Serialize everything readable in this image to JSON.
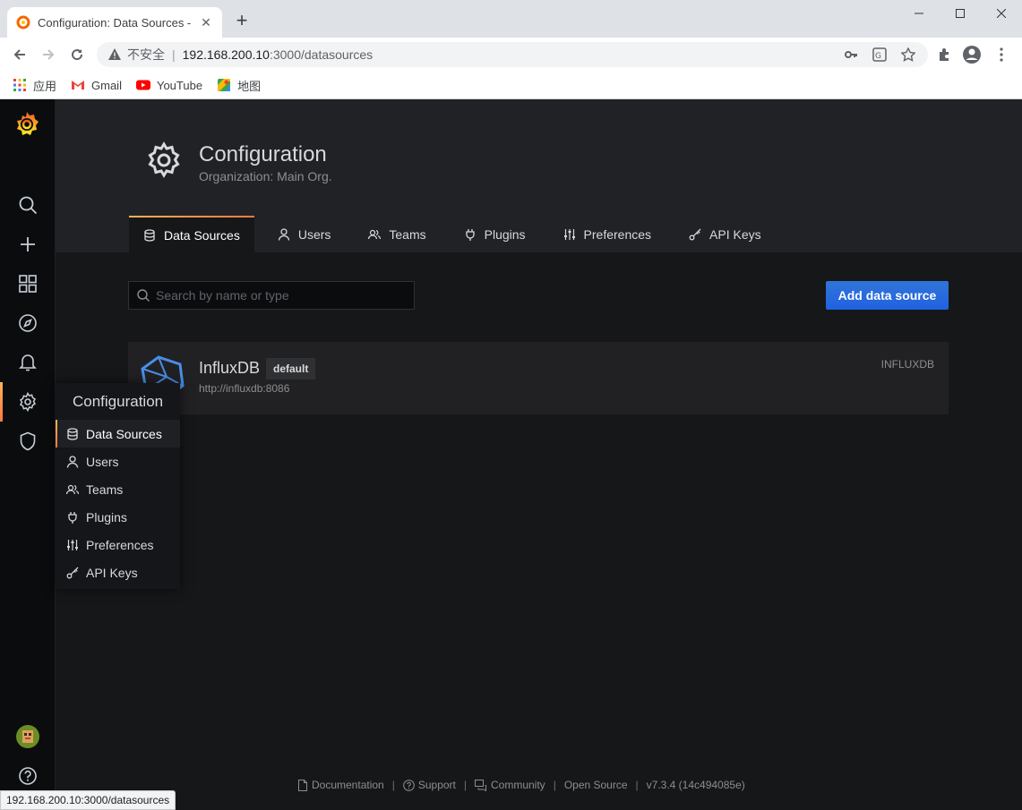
{
  "browser": {
    "tab_title": "Configuration: Data Sources -",
    "insecure_label": "不安全",
    "url_host": "192.168.200.10",
    "url_path": ":3000/datasources",
    "bookmarks": [
      {
        "label": "应用",
        "icon": "apps-grid-icon"
      },
      {
        "label": "Gmail",
        "icon": "gmail-icon"
      },
      {
        "label": "YouTube",
        "icon": "youtube-icon"
      },
      {
        "label": "地图",
        "icon": "maps-icon"
      }
    ],
    "status_url": "192.168.200.10:3000/datasources"
  },
  "sidemenu": {
    "items": [
      "search-icon",
      "plus-icon",
      "dashboards-icon",
      "explore-icon",
      "alerting-icon",
      "configuration-icon",
      "server-admin-icon",
      "profile-avatar",
      "help-icon"
    ]
  },
  "header": {
    "title": "Configuration",
    "subtitle": "Organization: Main Org."
  },
  "tabs": [
    {
      "label": "Data Sources",
      "icon": "database-icon",
      "active": true
    },
    {
      "label": "Users",
      "icon": "user-icon"
    },
    {
      "label": "Teams",
      "icon": "users-icon"
    },
    {
      "label": "Plugins",
      "icon": "plug-icon"
    },
    {
      "label": "Preferences",
      "icon": "sliders-icon"
    },
    {
      "label": "API Keys",
      "icon": "key-icon"
    }
  ],
  "search": {
    "placeholder": "Search by name or type",
    "value": ""
  },
  "add_button": "Add data source",
  "datasources": [
    {
      "name": "InfluxDB",
      "badge": "default",
      "url": "http://influxdb:8086",
      "type": "INFLUXDB"
    }
  ],
  "dropdown": {
    "title": "Configuration",
    "items": [
      "Data Sources",
      "Users",
      "Teams",
      "Plugins",
      "Preferences",
      "API Keys"
    ]
  },
  "footer": {
    "documentation": "Documentation",
    "support": "Support",
    "community": "Community",
    "open_source": "Open Source",
    "version": "v7.3.4 (14c494085e)"
  },
  "colors": {
    "accent": "#3274d9",
    "active_gradient_start": "#ffb357",
    "active_gradient_end": "#ff7941"
  }
}
